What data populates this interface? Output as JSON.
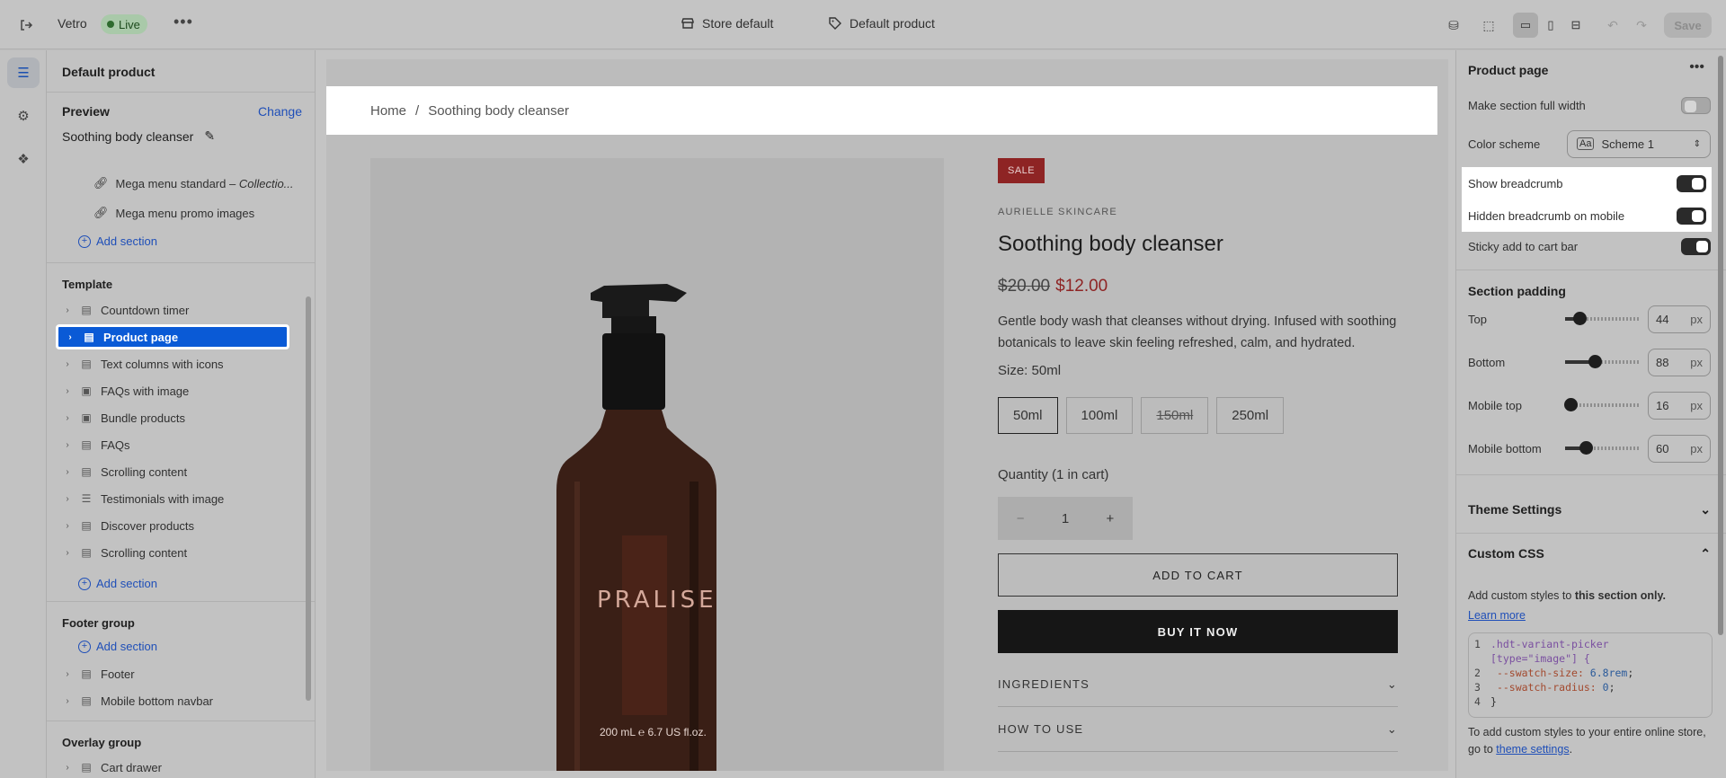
{
  "topbar": {
    "store_name": "Vetro",
    "status": "Live",
    "context_store": "Store default",
    "context_product": "Default product",
    "save_label": "Save"
  },
  "sidebar": {
    "header": "Default product",
    "preview_label": "Preview",
    "change_label": "Change",
    "preview_value": "Soothing body cleanser",
    "header_items": [
      {
        "label": "Mega menu standard – ",
        "italic": "Collectio..."
      },
      {
        "label": "Mega menu promo images"
      }
    ],
    "add_section": "Add section",
    "template_label": "Template",
    "template_items": [
      {
        "label": "Countdown timer",
        "icon": "section-icon"
      },
      {
        "label": "Product page",
        "icon": "section-icon",
        "selected": true
      },
      {
        "label": "Text columns with icons",
        "icon": "section-icon"
      },
      {
        "label": "FAQs with image",
        "icon": "image-icon"
      },
      {
        "label": "Bundle products",
        "icon": "image-icon"
      },
      {
        "label": "FAQs",
        "icon": "section-icon"
      },
      {
        "label": "Scrolling content",
        "icon": "section-icon"
      },
      {
        "label": "Testimonials with image",
        "icon": "list-icon"
      },
      {
        "label": "Discover products",
        "icon": "section-icon"
      },
      {
        "label": "Scrolling content",
        "icon": "section-icon"
      }
    ],
    "footer_group_label": "Footer group",
    "footer_items": [
      {
        "label": "Footer"
      },
      {
        "label": "Mobile bottom navbar"
      }
    ],
    "overlay_group_label": "Overlay group",
    "overlay_items": [
      {
        "label": "Cart drawer"
      }
    ]
  },
  "preview": {
    "breadcrumb_home": "Home",
    "breadcrumb_sep": "/",
    "breadcrumb_current": "Soothing body cleanser",
    "bottle_brand": "PRALISE",
    "bottle_volume": "200 mL ℮ 6.7 US fl.oz.",
    "badge": "SALE",
    "vendor": "AURIELLE SKINCARE",
    "title": "Soothing body cleanser",
    "price_old": "$20.00",
    "price_new": "$12.00",
    "description": "Gentle body wash that cleanses without drying. Infused with soothing botanicals to leave skin feeling refreshed, calm, and hydrated.",
    "size_label": "Size: 50ml",
    "sizes": [
      "50ml",
      "100ml",
      "150ml",
      "250ml"
    ],
    "quantity_label": "Quantity (1 in cart)",
    "quantity_value": "1",
    "add_to_cart": "ADD TO CART",
    "buy_now": "BUY IT NOW",
    "accordions": [
      "INGREDIENTS",
      "HOW TO USE"
    ]
  },
  "settings": {
    "title": "Product page",
    "full_width_label": "Make section full width",
    "color_scheme_label": "Color scheme",
    "color_scheme_value": "Scheme 1",
    "show_breadcrumb_label": "Show breadcrumb",
    "hidden_breadcrumb_label": "Hidden breadcrumb on mobile",
    "sticky_label": "Sticky add to cart bar",
    "padding_title": "Section padding",
    "padding": [
      {
        "label": "Top",
        "value": "44",
        "fraction": 0.2
      },
      {
        "label": "Bottom",
        "value": "88",
        "fraction": 0.4
      },
      {
        "label": "Mobile top",
        "value": "16",
        "fraction": 0.07
      },
      {
        "label": "Mobile bottom",
        "value": "60",
        "fraction": 0.28
      }
    ],
    "unit": "px",
    "theme_settings": "Theme Settings",
    "custom_css": "Custom CSS",
    "css_intro": "Add custom styles to ",
    "css_intro_bold": "this section only.",
    "learn_more": "Learn more",
    "code_lines": [
      {
        "n": "1",
        "sel": ".hdt-variant-picker"
      },
      {
        "n": "",
        "sel": "[type=\"image\"] {"
      },
      {
        "n": "2",
        "prop": "--swatch-size: ",
        "val": "6.8rem",
        "end": ";"
      },
      {
        "n": "3",
        "prop": "--swatch-radius: ",
        "val": "0",
        "end": ";"
      },
      {
        "n": "4",
        "sel": "}"
      }
    ],
    "footer_text": "To add custom styles to your entire online store, go to ",
    "theme_settings_link": "theme settings",
    "footer_end": "."
  }
}
